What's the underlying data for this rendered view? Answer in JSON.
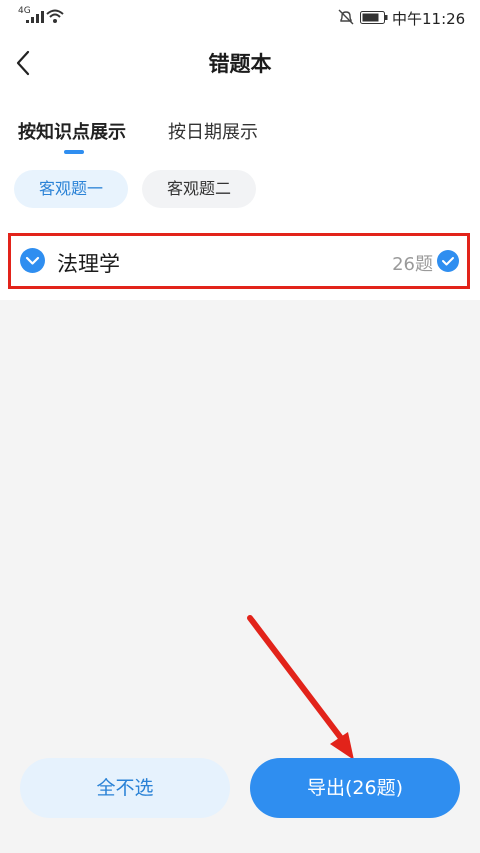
{
  "status_bar": {
    "network": "4G",
    "time": "中午11:26"
  },
  "header": {
    "title": "错题本"
  },
  "tabs": [
    {
      "label": "按知识点展示",
      "active": true
    },
    {
      "label": "按日期展示",
      "active": false
    }
  ],
  "filters": [
    {
      "label": "客观题一",
      "selected": true
    },
    {
      "label": "客观题二",
      "selected": false
    }
  ],
  "subject_row": {
    "label": "法理学",
    "count": "26题",
    "checked": true
  },
  "footer": {
    "deselect_all_label": "全不选",
    "export_label": "导出(26题)"
  },
  "colors": {
    "accent": "#2f8ef0",
    "highlight_box": "#e2231a",
    "arrow": "#e2231a"
  }
}
